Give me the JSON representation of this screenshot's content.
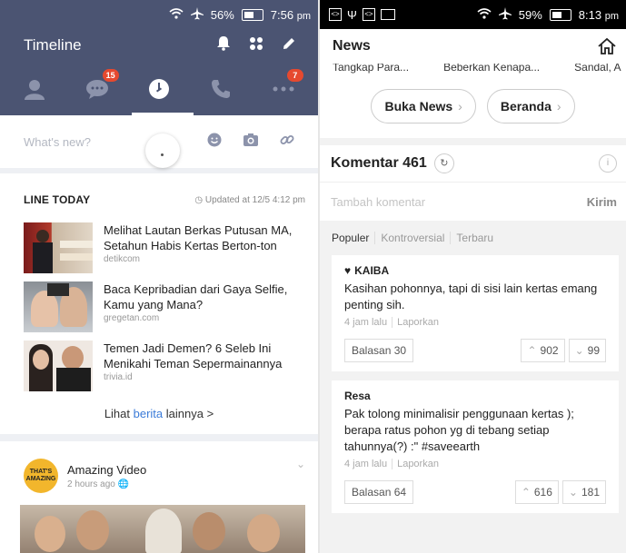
{
  "left": {
    "status": {
      "signal": "56%",
      "time": "7:56",
      "time_suffix": "pm"
    },
    "header": {
      "title": "Timeline"
    },
    "tabs": {
      "chats_badge": "15",
      "more_badge": "7"
    },
    "composer": {
      "placeholder": "What's new?"
    },
    "line_today": {
      "title": "LINE TODAY",
      "updated": "Updated at 12/5 4:12 pm",
      "items": [
        {
          "title": "Melihat Lautan Berkas Putusan MA, Setahun Habis Kertas Berton-ton",
          "source": "detikcom"
        },
        {
          "title": "Baca Kepribadian dari Gaya Selfie, Kamu yang Mana?",
          "source": "gregetan.com"
        },
        {
          "title": "Temen Jadi Demen? 6 Seleb Ini Menikahi Teman Sepermainannya",
          "source": "trivia.id"
        }
      ],
      "more_prefix": "Lihat ",
      "more_highlight": "berita",
      "more_suffix": " lainnya",
      "more_arrow": ">"
    },
    "post": {
      "logo_top": "THAT'S",
      "logo_bottom": "AMAZING",
      "name": "Amazing Video",
      "time": "2 hours ago"
    }
  },
  "right": {
    "status": {
      "battery": "59%",
      "time": "8:13",
      "time_suffix": "pm"
    },
    "header": {
      "title": "News"
    },
    "strip": [
      "Tangkap Para...",
      "Beberkan Kenapa...",
      "Sandal, A"
    ],
    "pills": [
      {
        "label": "Buka News"
      },
      {
        "label": "Beranda"
      }
    ],
    "comments": {
      "title": "Komentar 461",
      "placeholder": "Tambah komentar",
      "send": "Kirim",
      "filters": [
        "Populer",
        "Kontroversial",
        "Terbaru"
      ],
      "items": [
        {
          "author": "KAIBA",
          "text": "Kasihan pohonnya, tapi di sisi lain kertas emang penting sih.",
          "time": "4 jam lalu",
          "report": "Laporkan",
          "replies": "Balasan 30",
          "up": "902",
          "down": "99"
        },
        {
          "author": "Resa",
          "text": "Pak tolong minimalisir penggunaan kertas ); berapa ratus pohon yg di tebang setiap tahunnya(?) :\" #saveearth",
          "time": "4 jam lalu",
          "report": "Laporkan",
          "replies": "Balasan 64",
          "up": "616",
          "down": "181"
        }
      ]
    }
  }
}
